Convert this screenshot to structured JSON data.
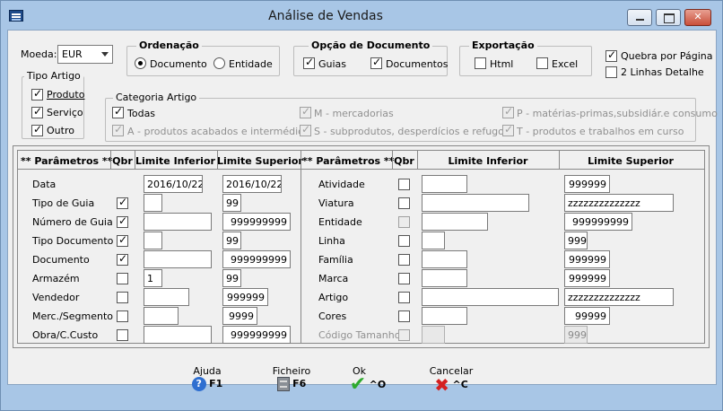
{
  "window": {
    "title": "Análise de Vendas"
  },
  "moeda": {
    "label": "Moeda:",
    "value": "EUR"
  },
  "ordenacao": {
    "title": "Ordenação",
    "opt1": "Documento",
    "opt2": "Entidade",
    "selected": "Documento"
  },
  "opcao_documento": {
    "title": "Opção de Documento",
    "guias": "Guias",
    "documentos": "Documentos"
  },
  "exportacao": {
    "title": "Exportação",
    "html": "Html",
    "excel": "Excel"
  },
  "quebra": {
    "label": "Quebra por Página",
    "checked": true
  },
  "duas_linhas": {
    "label": "2 Linhas Detalhe",
    "checked": false
  },
  "tipo_artigo": {
    "title": "Tipo Artigo",
    "produto": "Produto",
    "servico": "Serviço",
    "outro": "Outro"
  },
  "categoria": {
    "title": "Categoria Artigo",
    "todas": "Todas",
    "m": "M - mercadorias",
    "p": "P - matérias-primas,subsidiár.e consumo",
    "a": "A - produtos acabados e intermédios",
    "s": "S - subprodutos, desperdícios e refugos",
    "t": "T - produtos e trabalhos em curso"
  },
  "grid": {
    "h_param": "** Parâmetros **",
    "h_qbr": "Qbr",
    "h_inf": "Limite Inferior",
    "h_sup": "Limite Superior",
    "left": [
      {
        "label": "Data",
        "qbr": null,
        "inf": "2016/10/22",
        "sup": "2016/10/22"
      },
      {
        "label": "Tipo de Guia",
        "qbr": true,
        "inf": "",
        "sup": "99"
      },
      {
        "label": "Número de Guia",
        "qbr": true,
        "inf": "",
        "sup": "999999999"
      },
      {
        "label": "Tipo Documento",
        "qbr": true,
        "inf": "",
        "sup": "99"
      },
      {
        "label": "Documento",
        "qbr": true,
        "inf": "",
        "sup": "999999999"
      },
      {
        "label": "Armazém",
        "qbr": false,
        "inf": "1",
        "sup": "99"
      },
      {
        "label": "Vendedor",
        "qbr": false,
        "inf": "",
        "sup": "999999"
      },
      {
        "label": "Merc./Segmento",
        "qbr": false,
        "inf": "",
        "sup": "9999"
      },
      {
        "label": "Obra/C.Custo",
        "qbr": false,
        "inf": "",
        "sup": "999999999"
      }
    ],
    "right": [
      {
        "label": "Atividade",
        "inf": "",
        "sup": "999999"
      },
      {
        "label": "Viatura",
        "inf": "",
        "sup": "zzzzzzzzzzzzzz"
      },
      {
        "label": "Entidade",
        "inf": "",
        "sup": "999999999"
      },
      {
        "label": "Linha",
        "inf": "",
        "sup": "999"
      },
      {
        "label": "Família",
        "inf": "",
        "sup": "999999"
      },
      {
        "label": "Marca",
        "inf": "",
        "sup": "999999"
      },
      {
        "label": "Artigo",
        "inf": "",
        "sup": "zzzzzzzzzzzzzz"
      },
      {
        "label": "Cores",
        "inf": "",
        "sup": "99999"
      },
      {
        "label": "Código Tamanho",
        "inf": "",
        "sup": "999"
      }
    ]
  },
  "toolbar": {
    "ajuda": "Ajuda",
    "ajuda_key": "F1",
    "ficheiro": "Ficheiro",
    "ficheiro_key": "F6",
    "ok": "Ok",
    "ok_key": "^O",
    "cancelar": "Cancelar",
    "cancelar_key": "^C"
  },
  "colors": {
    "frame": "#a8c6e6",
    "ok": "#2eaa2e",
    "cancel": "#d42020",
    "help": "#2f6fd0"
  }
}
